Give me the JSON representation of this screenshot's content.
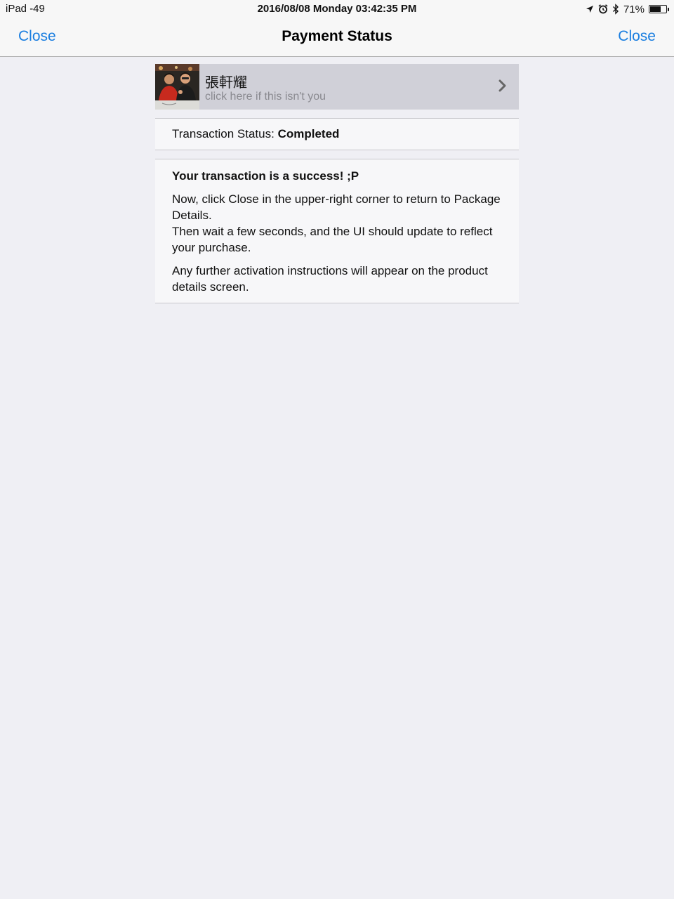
{
  "statusbar": {
    "device": "iPad  -49",
    "datetime": "2016/08/08 Monday 03:42:35 PM",
    "battery_percent": "71%",
    "battery_level": 0.71,
    "icons": [
      "location-arrow-icon",
      "alarm-clock-icon",
      "bluetooth-icon",
      "battery-icon"
    ]
  },
  "navbar": {
    "left_button": "Close",
    "title": "Payment Status",
    "right_button": "Close",
    "accent_color": "#1a7ee0"
  },
  "user": {
    "name": "張軒耀",
    "subtitle": "click here if this isn't you"
  },
  "transaction": {
    "label": "Transaction Status:",
    "value": "Completed"
  },
  "message": {
    "heading": "Your transaction is a success! ;P",
    "line1": "Now, click Close in the upper-right corner to return to Package Details.",
    "line2": "Then wait a few seconds, and the UI should update to reflect your purchase.",
    "line3": "Any further activation instructions will appear on the product details screen."
  }
}
